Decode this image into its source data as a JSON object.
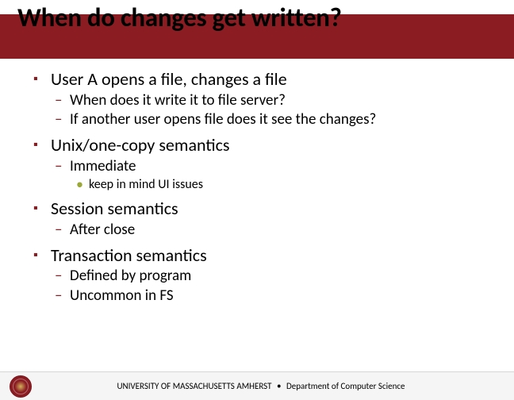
{
  "title": "When do changes get written?",
  "items": {
    "i1": "User A opens a file, changes a file",
    "i1a": "When does it write it to file server?",
    "i1b": "If another user opens file does it see the changes?",
    "i2": "Unix/one-copy semantics",
    "i2a": "Immediate",
    "i2a1": "keep in mind UI issues",
    "i3": "Session semantics",
    "i3a": "After close",
    "i4": "Transaction semantics",
    "i4a": "Defined by program",
    "i4b": "Uncommon in FS"
  },
  "footer": {
    "university": "UNIVERSITY OF MASSACHUSETTS AMHERST",
    "separator": "•",
    "department": "Department of Computer Science"
  }
}
